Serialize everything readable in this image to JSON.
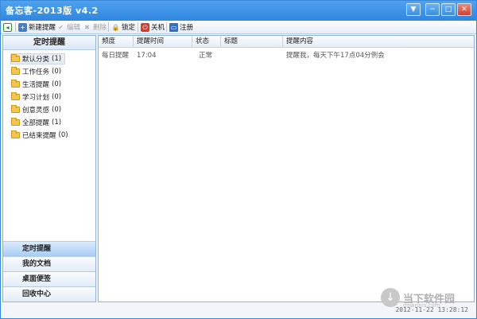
{
  "title": "备忘客-2013版 v4.2",
  "window_controls": {
    "menu": "▼",
    "minimize": "−",
    "maximize": "□",
    "close": "✕"
  },
  "toolbar": {
    "items": [
      {
        "label": "新建提醒",
        "icon": "new-reminder-icon",
        "enabled": true
      },
      {
        "label": "编辑",
        "icon": "edit-check-icon",
        "enabled": false
      },
      {
        "label": "删除",
        "icon": "delete-x-icon",
        "enabled": false
      },
      {
        "label": "锁定",
        "icon": "lock-icon",
        "enabled": true
      },
      {
        "label": "关机",
        "icon": "power-icon",
        "enabled": true
      },
      {
        "label": "注册",
        "icon": "monitor-icon",
        "enabled": true
      }
    ]
  },
  "sidebar": {
    "header": "定时提醒",
    "categories": [
      {
        "label": "默认分类",
        "count": "(1)"
      },
      {
        "label": "工作任务",
        "count": "(0)"
      },
      {
        "label": "生活提醒",
        "count": "(0)"
      },
      {
        "label": "学习计划",
        "count": "(0)"
      },
      {
        "label": "创意灵感",
        "count": "(0)"
      },
      {
        "label": "全部提醒",
        "count": "(1)"
      },
      {
        "label": "已结束提醒",
        "count": "(0)"
      }
    ],
    "nav": [
      "定时提醒",
      "我的文档",
      "桌面便签",
      "回收中心"
    ]
  },
  "table": {
    "columns": [
      "频度",
      "提醒时间",
      "状态",
      "标题",
      "提醒内容"
    ],
    "rows": [
      [
        "每日提醒",
        "17:04",
        "正常",
        "",
        "提醒我，每天下午17点04分例会"
      ]
    ]
  },
  "status": {
    "datetime": "2012-11-22 13:28:12"
  },
  "watermark": {
    "text": "当下软件园",
    "sub": "downxia.com"
  }
}
